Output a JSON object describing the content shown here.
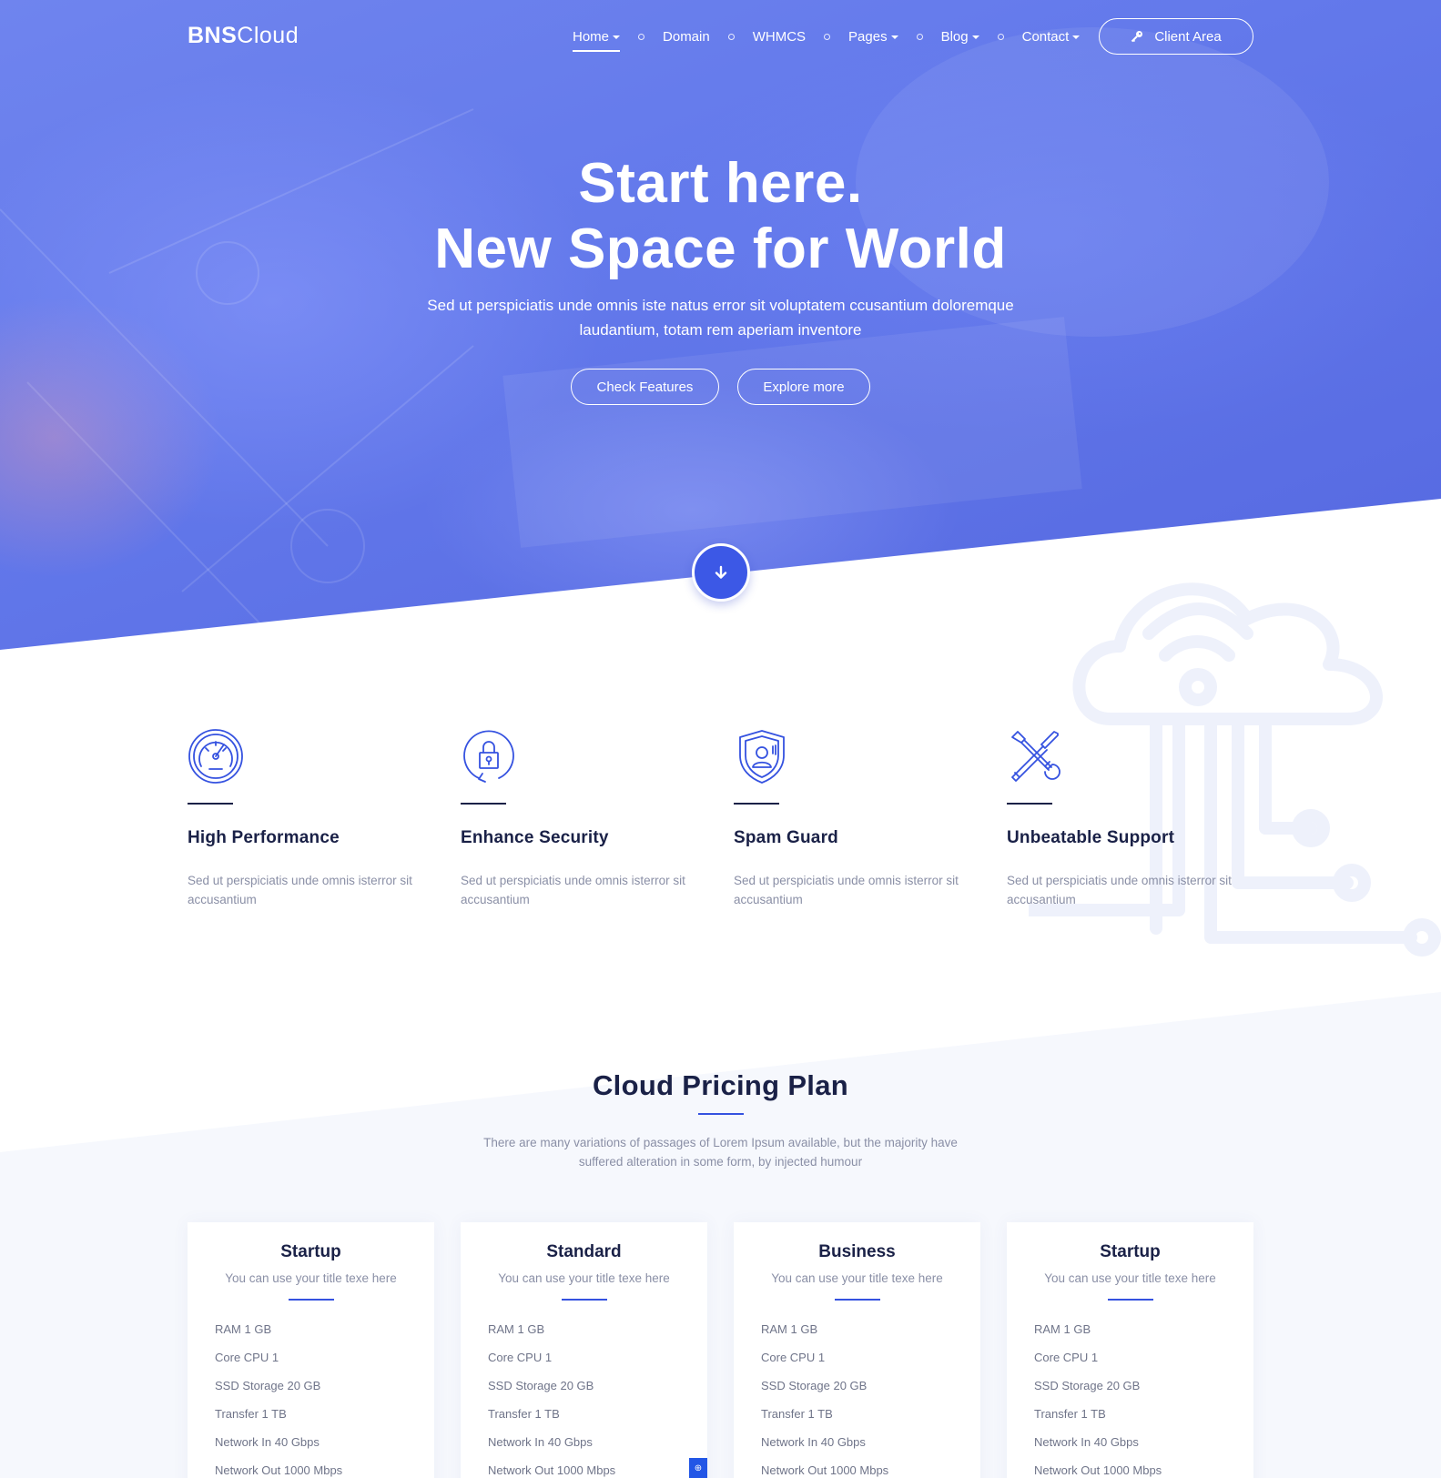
{
  "brand": {
    "bold": "BNS",
    "light": "Cloud"
  },
  "nav": {
    "items": [
      {
        "label": "Home",
        "dropdown": true,
        "active": true
      },
      {
        "label": "Domain",
        "dropdown": false
      },
      {
        "label": "WHMCS",
        "dropdown": false
      },
      {
        "label": "Pages",
        "dropdown": true
      },
      {
        "label": "Blog",
        "dropdown": true
      },
      {
        "label": "Contact",
        "dropdown": true
      }
    ],
    "client_area": "Client Area",
    "client_area_icon": "key-icon"
  },
  "hero": {
    "title_line1": "Start here.",
    "title_line2": "New Space for World",
    "subtitle_line1": "Sed ut perspiciatis unde omnis iste natus error sit voluptatem ccusantium doloremque",
    "subtitle_line2": "laudantium, totam rem aperiam inventore",
    "btn_primary": "Check Features",
    "btn_secondary": "Explore more",
    "scroll_icon": "arrow-down-icon"
  },
  "features": [
    {
      "icon": "speedometer-icon",
      "title": "High Performance",
      "desc": "Sed ut perspiciatis unde omnis isterror sit accusantium"
    },
    {
      "icon": "lock-icon",
      "title": "Enhance Security",
      "desc": "Sed ut perspiciatis unde omnis isterror sit accusantium"
    },
    {
      "icon": "shield-user-icon",
      "title": "Spam Guard",
      "desc": "Sed ut perspiciatis unde omnis isterror sit accusantium"
    },
    {
      "icon": "tools-icon",
      "title": "Unbeatable Support",
      "desc": "Sed ut perspiciatis unde omnis isterror sit accusantium"
    }
  ],
  "pricing": {
    "title": "Cloud Pricing Plan",
    "subtitle_line1": "There are many variations of passages of Lorem Ipsum available, but the majority have",
    "subtitle_line2": "suffered alteration in some form, by injected humour",
    "plans": [
      {
        "name": "Startup",
        "tagline": "You can use your title texe here",
        "features": [
          "RAM 1 GB",
          "Core CPU 1",
          "SSD Storage 20 GB",
          "Transfer 1 TB",
          "Network In 40 Gbps",
          "Network Out 1000 Mbps"
        ]
      },
      {
        "name": "Standard",
        "tagline": "You can use your title texe here",
        "features": [
          "RAM 1 GB",
          "Core CPU 1",
          "SSD Storage 20 GB",
          "Transfer 1 TB",
          "Network In 40 Gbps",
          "Network Out 1000 Mbps"
        ]
      },
      {
        "name": "Business",
        "tagline": "You can use your title texe here",
        "features": [
          "RAM 1 GB",
          "Core CPU 1",
          "SSD Storage 20 GB",
          "Transfer 1 TB",
          "Network In 40 Gbps",
          "Network Out 1000 Mbps"
        ]
      },
      {
        "name": "Startup",
        "tagline": "You can use your title texe here",
        "features": [
          "RAM 1 GB",
          "Core CPU 1",
          "SSD Storage 20 GB",
          "Transfer 1 TB",
          "Network In 40 Gbps",
          "Network Out 1000 Mbps"
        ]
      }
    ]
  },
  "colors": {
    "primary": "#3552e0",
    "hero": "#6379eb",
    "heading": "#1a2147",
    "muted": "#8a8fa6"
  }
}
